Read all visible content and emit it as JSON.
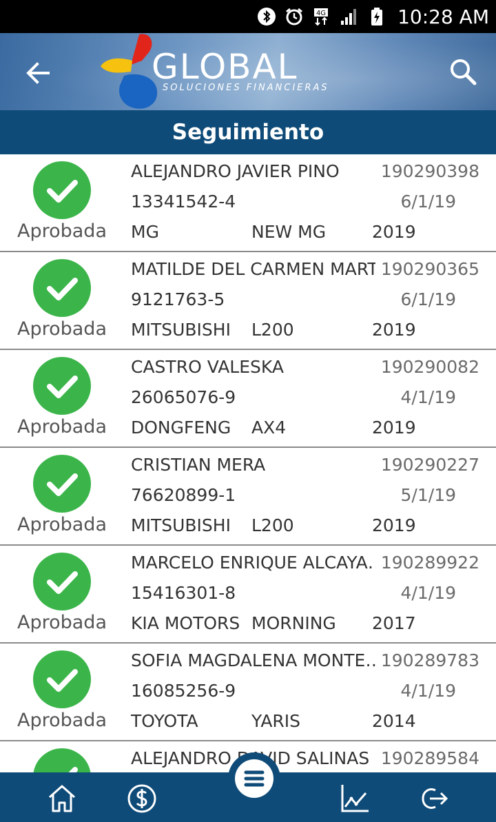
{
  "status_bar": {
    "time": "10:28 AM",
    "network_label": "4G",
    "icons": [
      "bluetooth-icon",
      "alarm-icon",
      "network-4g-icon",
      "signal-icon",
      "battery-charging-icon"
    ]
  },
  "header": {
    "logo_text": "GLOBAL",
    "logo_subtitle": "SOLUCIONES FINANCIERAS",
    "back_icon": "arrow-left-icon",
    "search_icon": "search-icon"
  },
  "title": "Seguimiento",
  "colors": {
    "primary": "#0f4b78",
    "approved": "#3bb54a"
  },
  "applications": [
    {
      "name": "ALEJANDRO JAVIER PINO",
      "code": "190290398",
      "rut": "13341542-4",
      "date": "6/1/19",
      "brand": "MG",
      "model": "NEW MG",
      "year": "2019",
      "status": "Aprobada"
    },
    {
      "name": "MATILDE DEL CARMEN MART…",
      "code": "190290365",
      "rut": "9121763-5",
      "date": "6/1/19",
      "brand": "MITSUBISHI",
      "model": "L200",
      "year": "2019",
      "status": "Aprobada"
    },
    {
      "name": "CASTRO VALESKA",
      "code": "190290082",
      "rut": "26065076-9",
      "date": "4/1/19",
      "brand": "DONGFENG",
      "model": "AX4",
      "year": "2019",
      "status": "Aprobada"
    },
    {
      "name": "CRISTIAN MERA",
      "code": "190290227",
      "rut": "76620899-1",
      "date": "5/1/19",
      "brand": "MITSUBISHI",
      "model": "L200",
      "year": "2019",
      "status": "Aprobada"
    },
    {
      "name": "MARCELO ENRIQUE ALCAYA…",
      "code": "190289922",
      "rut": "15416301-8",
      "date": "4/1/19",
      "brand": "KIA MOTORS",
      "model": "MORNING",
      "year": "2017",
      "status": "Aprobada"
    },
    {
      "name": "SOFIA MAGDALENA MONTE…",
      "code": "190289783",
      "rut": "16085256-9",
      "date": "4/1/19",
      "brand": "TOYOTA",
      "model": "YARIS",
      "year": "2014",
      "status": "Aprobada"
    },
    {
      "name": "ALEJANDRO DAVID SALINAS",
      "code": "190289584",
      "rut": "",
      "date": "",
      "brand": "",
      "model": "",
      "year": "",
      "status": ""
    }
  ],
  "bottom_nav": {
    "items": [
      "home-icon",
      "dollar-icon",
      "menu-icon",
      "chart-icon",
      "logout-icon"
    ]
  }
}
